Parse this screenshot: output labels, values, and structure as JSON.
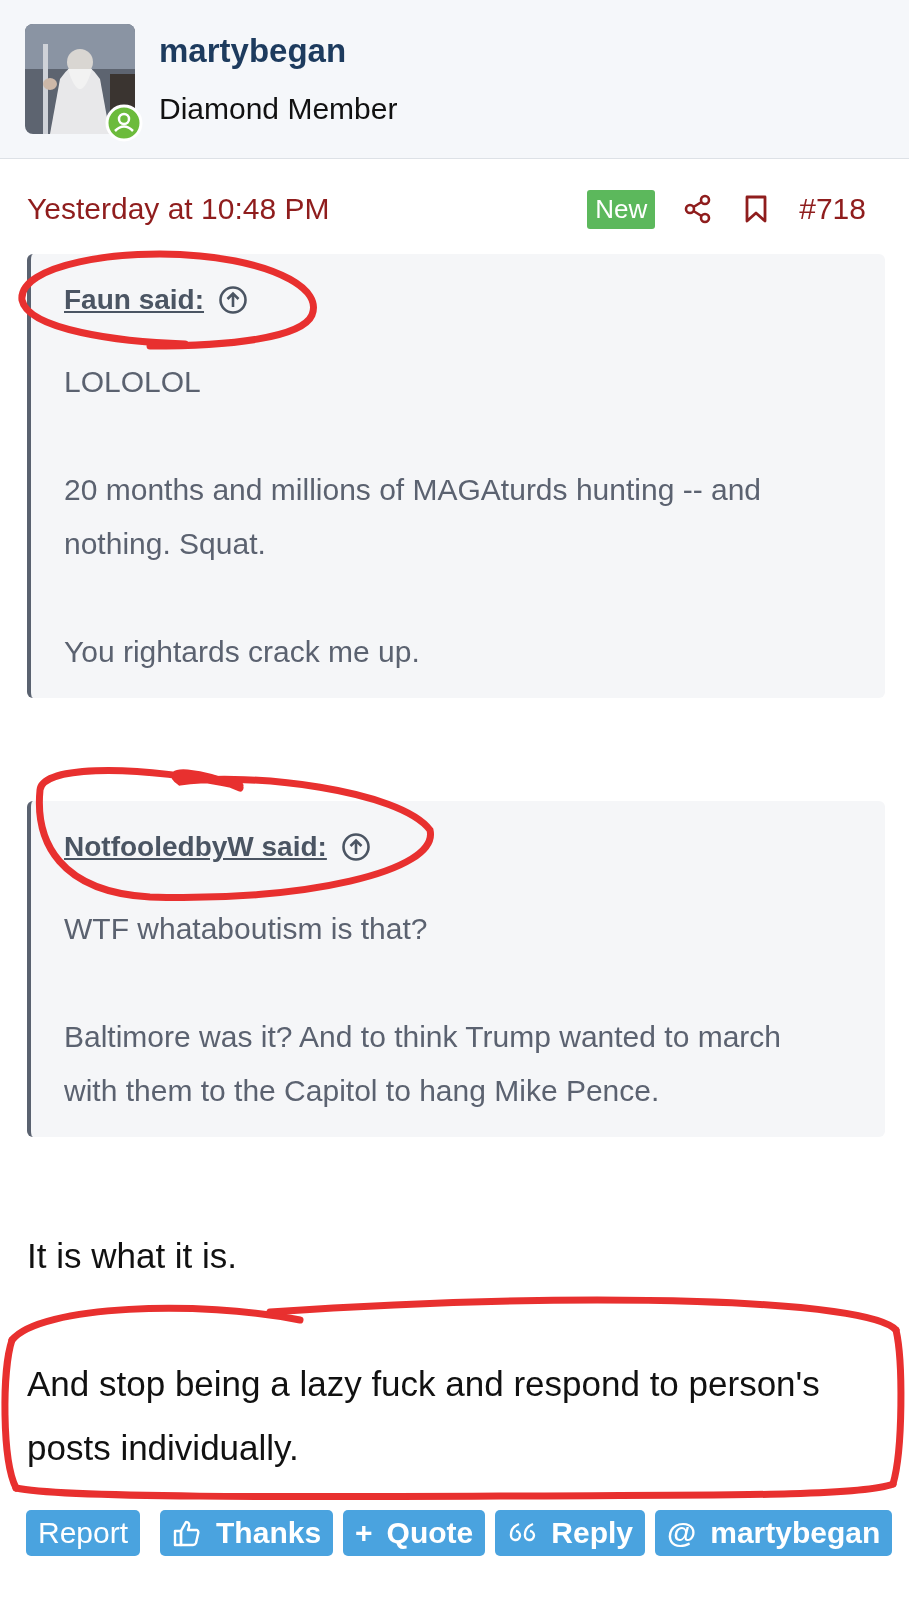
{
  "author": {
    "name": "martybegan",
    "title": "Diamond Member"
  },
  "post": {
    "date": "Yesterday at 10:48 PM",
    "badge": "New",
    "number": "#718"
  },
  "quotes": [
    {
      "author": "Faun said:",
      "paragraphs": [
        "LOLOLOL",
        "20 months and millions of MAGAturds hunting -- and nothing. Squat.",
        "You rightards crack me up."
      ]
    },
    {
      "author": "NotfooledbyW said:",
      "paragraphs": [
        "WTF whataboutism is that?",
        "Baltimore was it? And to think Trump wanted to march with them to the Capitol to hang Mike Pence."
      ]
    }
  ],
  "body": [
    "It is what it is.",
    "And stop being a lazy fuck and respond to person's posts individually."
  ],
  "actions": [
    {
      "kind": "plain",
      "label": "Report"
    },
    {
      "kind": "thumb",
      "label": "Thanks"
    },
    {
      "kind": "prefix",
      "prefix": "+",
      "label": "Quote"
    },
    {
      "kind": "quote-marks",
      "label": "Reply"
    },
    {
      "kind": "prefix",
      "prefix": "@",
      "label": "martybegan"
    }
  ]
}
